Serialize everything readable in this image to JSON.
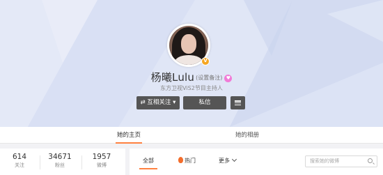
{
  "profile": {
    "name": "杨曦Lulu",
    "name_note": "(设置备注)",
    "member_icon": "member-icon",
    "verified_icon": "verified-v-icon",
    "intro": "东方卫视ViS2节目主持人"
  },
  "actions": {
    "follow_label": "⇄ 互相关注 ▾",
    "message_label": "私信",
    "more_icon": "menu-icon"
  },
  "tabs": {
    "home_label": "她的主页",
    "album_label": "她的相册"
  },
  "stats": [
    {
      "value": "614",
      "label": "关注"
    },
    {
      "value": "34671",
      "label": "粉丝"
    },
    {
      "value": "1957",
      "label": "微博"
    }
  ],
  "feed": {
    "all_label": "全部",
    "hot_label": "热门",
    "more_label": "更多",
    "search_placeholder": "搜索她的微博"
  },
  "colors": {
    "accent": "#ff8140",
    "button_bg": "#555555",
    "cover_bg": "#d6def3"
  }
}
